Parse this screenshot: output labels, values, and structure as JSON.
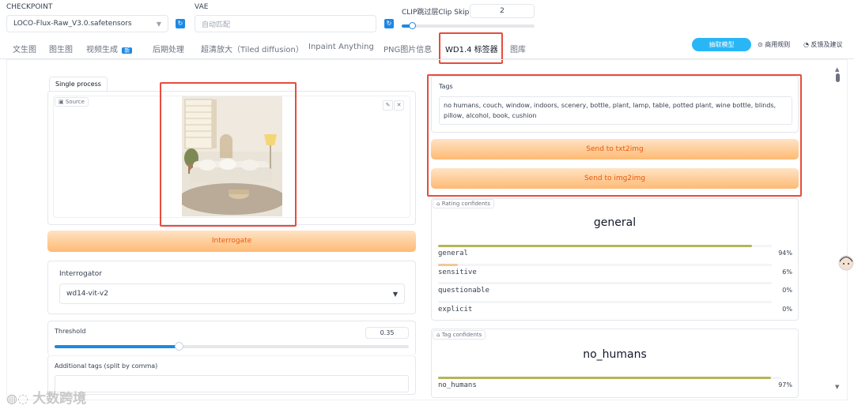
{
  "top": {
    "checkpoint_label": "CHECKPOINT",
    "checkpoint_value": "LOCO-Flux-Raw_V3.0.safetensors",
    "vae_label": "VAE",
    "vae_value": "自动匹配",
    "clip_label": "CLIP跳过层Clip Skip",
    "clip_value": "2",
    "clip_slider_percent": 8
  },
  "tabs": [
    "文生图",
    "图生图",
    "视频生成",
    "后期处理",
    "超清放大（Tiled diffusion）",
    "Inpaint Anything",
    "PNG图片信息",
    "WD1.4 标签器",
    "图库"
  ],
  "new_badge": "新",
  "active_tab": "WD1.4 标签器",
  "right_actions": {
    "primary_btn": "抽取模型",
    "rules": "商用规则",
    "feedback": "反馈及建议"
  },
  "left": {
    "subtab": "Single process",
    "source_label": "Source",
    "interrogate_btn": "Interrogate",
    "interrogator_label": "Interrogator",
    "interrogator_value": "wd14-vit-v2",
    "threshold_label": "Threshold",
    "threshold_value": "0.35",
    "threshold_percent": 35,
    "additional_tags_label": "Additional tags (split by comma)"
  },
  "right": {
    "tags_label": "Tags",
    "tags_value": "no humans, couch, window, indoors, scenery, bottle, plant, lamp, table, potted plant, wine bottle, blinds, pillow, alcohol, book, cushion",
    "send_txt2img": "Send to txt2img",
    "send_img2img": "Send to img2img",
    "rating_label": "Rating confidents",
    "rating_top": "general",
    "ratings": [
      {
        "name": "general",
        "pct": "94%",
        "value": 94
      },
      {
        "name": "sensitive",
        "pct": "6%",
        "value": 6
      },
      {
        "name": "questionable",
        "pct": "0%",
        "value": 0
      },
      {
        "name": "explicit",
        "pct": "0%",
        "value": 0
      }
    ],
    "tag_conf_label": "Tag confidents",
    "tag_top": "no_humans",
    "tags_conf": [
      {
        "name": "no_humans",
        "pct": "97%",
        "value": 97
      }
    ]
  },
  "watermark": "大数跨境",
  "colors": {
    "accent_blue": "#1e88e5",
    "orange": "#fdba74",
    "highlight_red": "#e74c3c",
    "bar": "#b4b55a"
  }
}
